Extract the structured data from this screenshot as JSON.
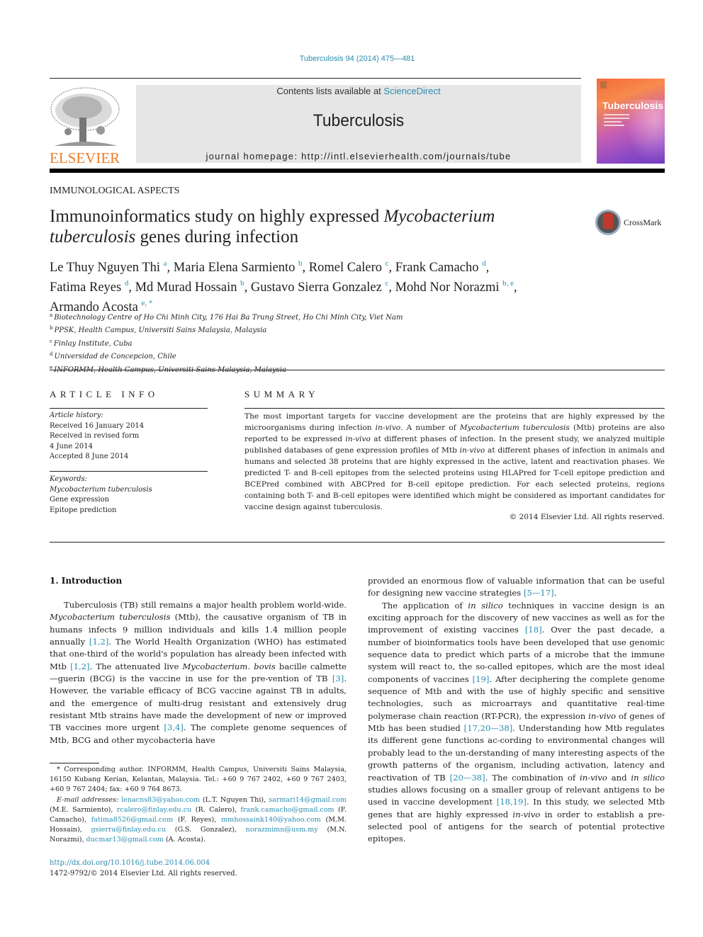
{
  "header": {
    "citation": "Tuberculosis 94 (2014) 475—481",
    "publisher_logo_text": "ELSEVIER",
    "contents_prefix": "Contents lists available at ",
    "contents_link": "ScienceDirect",
    "journal_name": "Tuberculosis",
    "homepage": "journal homepage: http://intl.elsevierhealth.com/journals/tube",
    "cover_title": "Tuberculosis",
    "brand_color": "#f07b22",
    "link_color": "#2a8cb0"
  },
  "article": {
    "section": "IMMUNOLOGICAL ASPECTS",
    "title_part1": "Immunoinformatics study on highly expressed ",
    "title_italic1": "Mycobacterium",
    "title_italic2": "tuberculosis",
    "title_part2": " genes during infection",
    "crossmark_label": "CrossMark",
    "authors": [
      {
        "name": "Le Thuy Nguyen Thi",
        "sup": "a",
        "sep": ", "
      },
      {
        "name": "Maria Elena Sarmiento",
        "sup": "b",
        "sep": ", "
      },
      {
        "name": "Romel Calero",
        "sup": "c",
        "sep": ", "
      },
      {
        "name": "Frank Camacho",
        "sup": "d",
        "sep": ","
      },
      {
        "name": "Fatima Reyes",
        "sup": "d",
        "sep": ", "
      },
      {
        "name": "Md Murad Hossain",
        "sup": "b",
        "sep": ", "
      },
      {
        "name": "Gustavo Sierra Gonzalez",
        "sup": "c",
        "sep": ", "
      },
      {
        "name": "Mohd Nor Norazmi",
        "sup": "b, e",
        "sep": ","
      },
      {
        "name": "Armando Acosta",
        "sup": "e, *",
        "sep": ""
      }
    ],
    "affiliations": [
      {
        "key": "a",
        "text": "Biotechnology Centre of Ho Chi Minh City, 176 Hai Ba Trung Street, Ho Chi Minh City, Viet Nam"
      },
      {
        "key": "b",
        "text": "PPSK, Health Campus, Universiti Sains Malaysia, Malaysia"
      },
      {
        "key": "c",
        "text": "Finlay Institute, Cuba"
      },
      {
        "key": "d",
        "text": "Universidad de Concepcion, Chile"
      },
      {
        "key": "e",
        "text": "INFORMM, Health Campus, Universiti Sains Malaysia, Malaysia"
      }
    ]
  },
  "article_info": {
    "heading": "ARTICLE INFO",
    "history_label": "Article history:",
    "history": [
      "Received 16 January 2014",
      "Received in revised form",
      "4 June 2014",
      "Accepted 8 June 2014"
    ],
    "keywords_label": "Keywords:",
    "keywords": [
      "Mycobacterium tuberculosis",
      "Gene expression",
      "Epitope prediction"
    ]
  },
  "summary": {
    "heading": "SUMMARY",
    "text_parts": [
      "The most important targets for vaccine development are the proteins that are highly expressed by the microorganisms during infection ",
      "in-vivo",
      ". A number of ",
      "Mycobacterium tuberculosis",
      " (Mtb) proteins are also reported to be expressed ",
      "in-vivo",
      " at different phases of infection. In the present study, we analyzed multiple published databases of gene expression profiles of Mtb ",
      "in-vivo",
      " at different phases of infection in animals and humans and selected 38 proteins that are highly expressed in the active, latent and reactivation phases. We predicted T- and B-cell epitopes from the selected proteins using HLAPred for T-cell epitope prediction and BCEPred combined with ABCPred for B-cell epitope prediction. For each selected proteins, regions containing both T- and B-cell epitopes were identified which might be considered as important candidates for vaccine design against tuberculosis."
    ],
    "copyright": "© 2014 Elsevier Ltd. All rights reserved."
  },
  "intro": {
    "heading": "1.  Introduction",
    "left_col": [
      "Tuberculosis (TB) still remains a major health problem world-wide. ",
      "Mycobacterium tuberculosis",
      " (Mtb), the causative organism of TB in humans infects 9 million individuals and kills 1.4 million people annually ",
      "[1,2]",
      ". The World Health Organization (WHO) has estimated that one-third of the world's population has already been infected with Mtb ",
      "[1,2]",
      ". The attenuated live ",
      "Mycobacterium. bovis",
      " bacille calmette—guerin (BCG) is the vaccine in use for the pre-vention of TB ",
      "[3]",
      ". However, the variable efficacy of BCG vaccine against TB in adults, and the emergence of multi-drug resistant and extensively drug resistant Mtb strains have made the development of new or improved TB vaccines more urgent ",
      "[3,4]",
      ". The complete genome sequences of Mtb, BCG and other mycobacteria have"
    ],
    "right_col_p1": [
      "provided an enormous flow of valuable information that can be useful for designing new vaccine strategies ",
      "[5—17]",
      "."
    ],
    "right_col_p2": [
      "The application of ",
      "in silico",
      " techniques in vaccine design is an exciting approach for the discovery of new vaccines as well as for the improvement of existing vaccines ",
      "[18]",
      ". Over the past decade, a number of bioinformatics tools have been developed that use genomic sequence data to predict which parts of a microbe that the immune system will react to, the so-called epitopes, which are the most ideal components of vaccines ",
      "[19]",
      ". After deciphering the complete genome sequence of Mtb and with the use of highly specific and sensitive technologies, such as microarrays and quantitative real-time polymerase chain reaction (RT-PCR), the expression ",
      "in-vivo",
      " of genes of Mtb has been studied ",
      "[17,20—38]",
      ". Understanding how Mtb regulates its different gene functions ac-cording to environmental changes will probably lead to the un-derstanding of many interesting aspects of the growth patterns of the organism, including activation, latency and reactivation of TB ",
      "[20—38]",
      ". The combination of ",
      "in-vivo",
      " and ",
      "in silico",
      " studies allows focusing on a smaller group of relevant antigens to be used in vaccine development ",
      "[18,19]",
      ". In this study, we selected Mtb genes that are highly expressed ",
      "in-vivo",
      " in order to establish a pre-selected pool of antigens for the search of potential protective epitopes."
    ]
  },
  "footnotes": {
    "corresponding": "* Corresponding author. INFORMM, Health Campus, Universiti Sains Malaysia, 16150 Kubang Kerian, Kelantan, Malaysia. Tel.: +60 9 767 2402, +60 9 767 2403, +60 9 767 2404; fax: +60 9 764 8673.",
    "email_label": "E-mail addresses:",
    "emails": [
      {
        "email": "lenacns83@yahoo.com",
        "who": " (L.T. Nguyen Thi), "
      },
      {
        "email": "sarmari14@gmail.com",
        "who": " (M.E. Sarmiento), "
      },
      {
        "email": "rcalero@finlay.edu.cu",
        "who": " (R. Calero), "
      },
      {
        "email": "frank.camacho@gmail.com",
        "who": " (F. Camacho), "
      },
      {
        "email": "fatima8526@gmail.com",
        "who": " (F. Reyes), "
      },
      {
        "email": "mmhossaink140@yahoo.com",
        "who": " (M.M. Hossain), "
      },
      {
        "email": "gsierra@finlay.edu.cu",
        "who": " (G.S. Gonzalez), "
      },
      {
        "email": "norazmimn@usm.my",
        "who": " (M.N. Norazmi), "
      },
      {
        "email": "ducmar13@gmail.com",
        "who": " (A. Acosta)."
      }
    ],
    "doi": "http://dx.doi.org/10.1016/j.tube.2014.06.004",
    "issn": "1472-9792/© 2014 Elsevier Ltd. All rights reserved."
  }
}
